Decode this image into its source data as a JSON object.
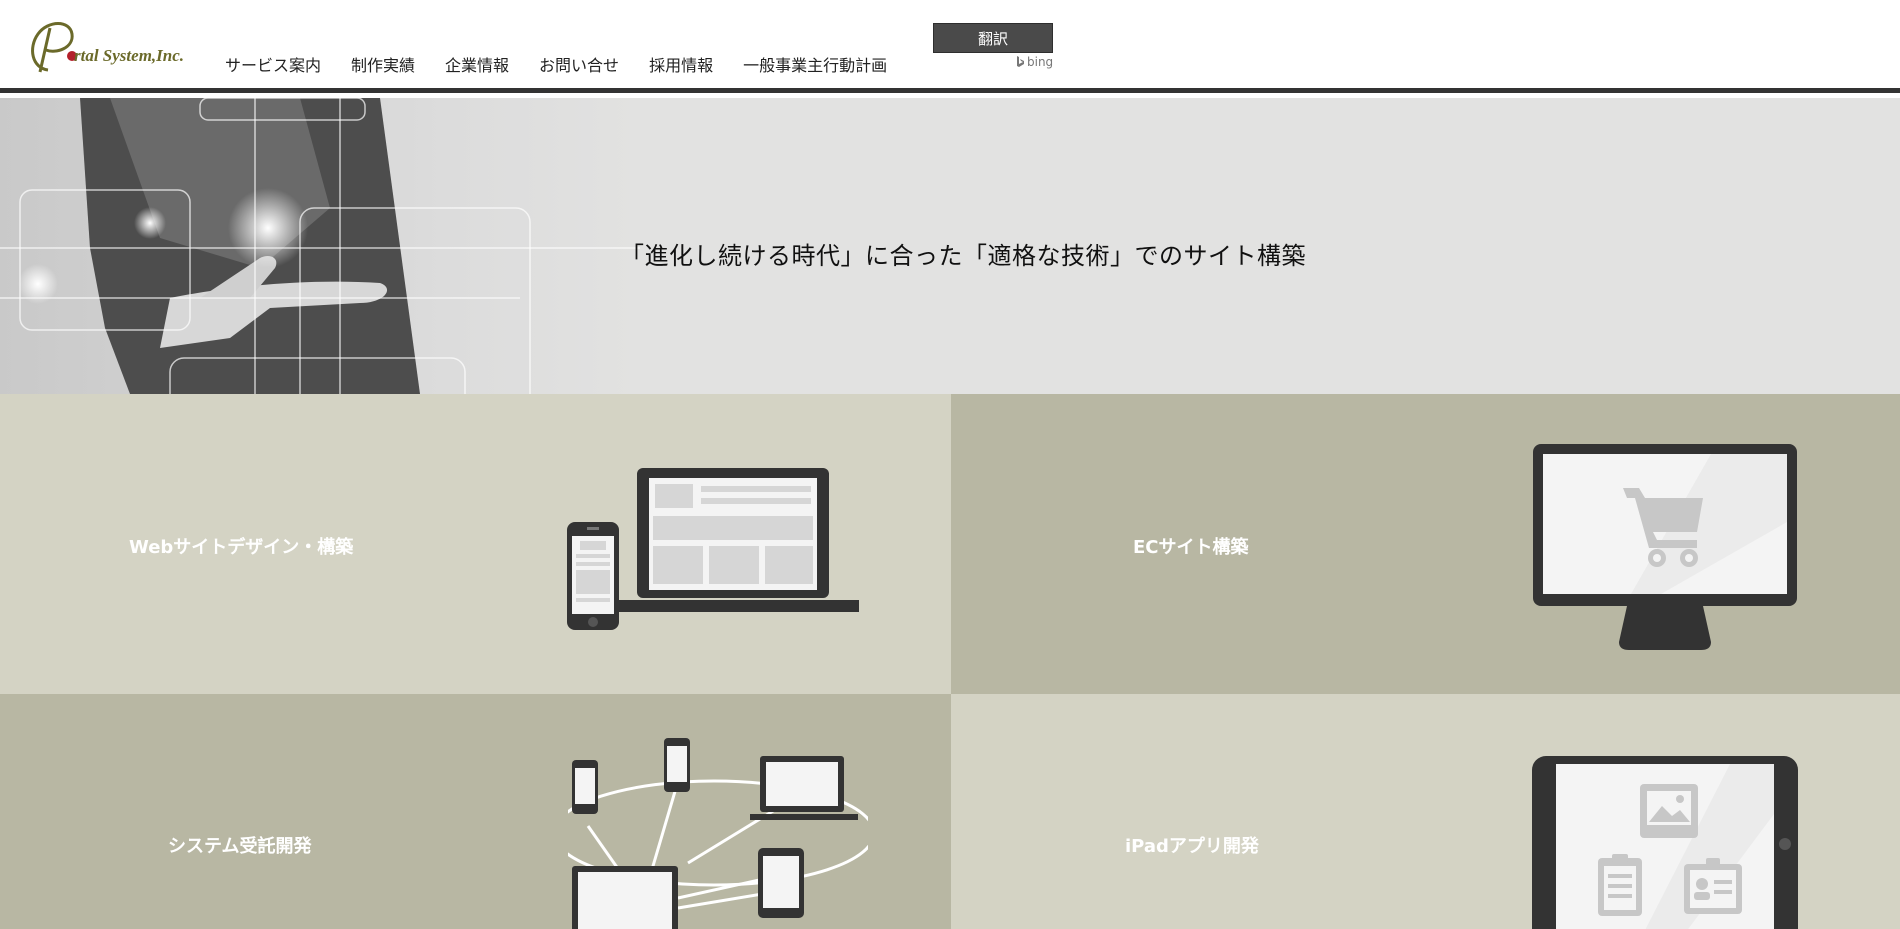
{
  "header": {
    "logo_text": "rtal System,Inc.",
    "nav": [
      {
        "label": "サービス案内"
      },
      {
        "label": "制作実績"
      },
      {
        "label": "企業情報"
      },
      {
        "label": "お問い合せ"
      },
      {
        "label": "採用情報"
      },
      {
        "label": "一般事業主行動計画"
      }
    ],
    "translate_label": "翻訳",
    "bing_label": "bing"
  },
  "hero": {
    "tagline": "「進化し続ける時代」に合った「適格な技術」でのサイト構築"
  },
  "tiles": [
    {
      "label": "Webサイトデザイン・構築",
      "icon": "responsive-devices-icon"
    },
    {
      "label": "ECサイト構築",
      "icon": "monitor-cart-icon"
    },
    {
      "label": "システム受託開発",
      "icon": "device-network-icon"
    },
    {
      "label": "iPadアプリ開発",
      "icon": "tablet-app-icon"
    }
  ],
  "colors": {
    "tile_light": "#d4d3c4",
    "tile_dark": "#b8b7a3",
    "hero_bg": "#e2e2e1",
    "logo_olive": "#6b6a2a",
    "logo_dot": "#b3202a"
  }
}
